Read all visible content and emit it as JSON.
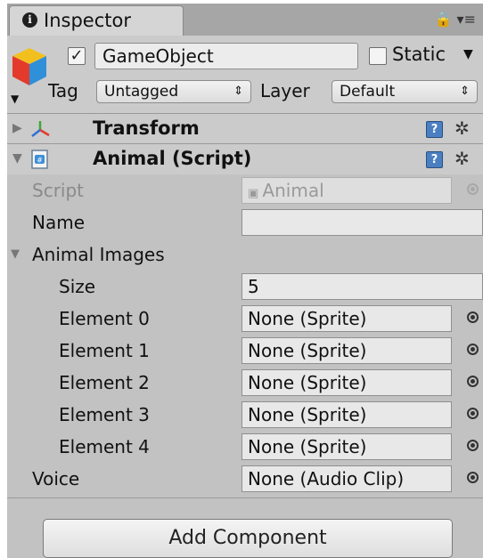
{
  "tab": {
    "label": "Inspector",
    "info_glyph": "i",
    "tools": "🔒 ▾≡"
  },
  "header": {
    "active_check": "✓",
    "object_name": "GameObject",
    "static_label": "Static",
    "static_caret": "▼",
    "tag_label": "Tag",
    "tag_value": "Untagged",
    "layer_label": "Layer",
    "layer_value": "Default",
    "dropdown_arrow": "⇕"
  },
  "components": {
    "transform": {
      "name": "Transform",
      "fold": "▶"
    },
    "script": {
      "name": "Animal (Script)",
      "fold": "▼"
    },
    "help_glyph": "?",
    "gear_glyph": "✲"
  },
  "properties": {
    "script": {
      "label": "Script",
      "value": "Animal"
    },
    "name": {
      "label": "Name",
      "value": ""
    },
    "animal_images": {
      "label": "Animal Images",
      "fold": "▼"
    },
    "size": {
      "label": "Size",
      "value": "5"
    },
    "elements": [
      {
        "label": "Element 0",
        "value": "None (Sprite)"
      },
      {
        "label": "Element 1",
        "value": "None (Sprite)"
      },
      {
        "label": "Element 2",
        "value": "None (Sprite)"
      },
      {
        "label": "Element 3",
        "value": "None (Sprite)"
      },
      {
        "label": "Element 4",
        "value": "None (Sprite)"
      }
    ],
    "voice": {
      "label": "Voice",
      "value": "None (Audio Clip)"
    }
  },
  "add_component_label": "Add Component",
  "colors": {
    "panel_bg": "#c2c2c2",
    "tab_bar_bg": "#a6a6a6",
    "help_icon": "#4a7fc1",
    "cube_red": "#e33a2b",
    "cube_blue": "#2f8fd9",
    "cube_yellow": "#f2c01e"
  }
}
